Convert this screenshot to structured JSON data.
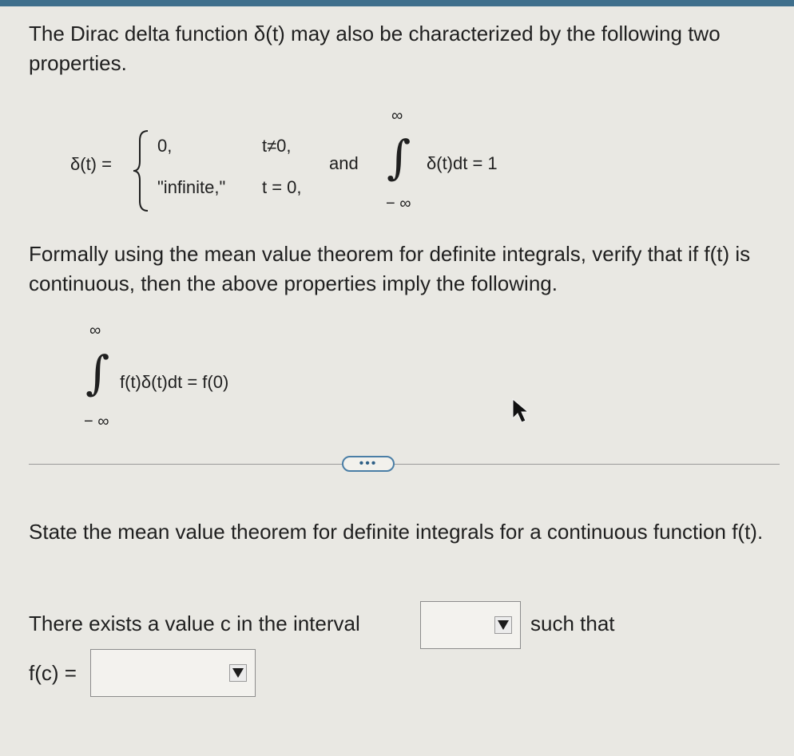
{
  "intro": "The Dirac delta function δ(t) may also be characterized by the following two properties.",
  "piecewise": {
    "lhs": "δ(t) =",
    "case1_value": "0,",
    "case1_cond": "t≠0,",
    "case2_value": "\"infinite,\"",
    "case2_cond": "t = 0,",
    "and": "and",
    "upper": "∞",
    "lower": "− ∞",
    "integrand": "δ(t)dt = 1"
  },
  "formally": "Formally using the mean value theorem for definite integrals, verify that if f(t) is continuous, then the above properties imply the following.",
  "target_identity": {
    "upper": "∞",
    "lower": "− ∞",
    "integrand": "f(t)δ(t)dt = f(0)"
  },
  "more_button": "•••",
  "state_prompt": "State the mean value theorem for definite integrals for a continuous function f(t).",
  "exists_text": "There exists a value c in the interval",
  "such_that": "such that",
  "fc_label": "f(c) =",
  "interval_select": {
    "value": ""
  },
  "fc_select": {
    "value": ""
  },
  "colors": {
    "background": "#e9e8e3",
    "accent": "#3f6f8c",
    "button_border": "#4a7ea6"
  }
}
